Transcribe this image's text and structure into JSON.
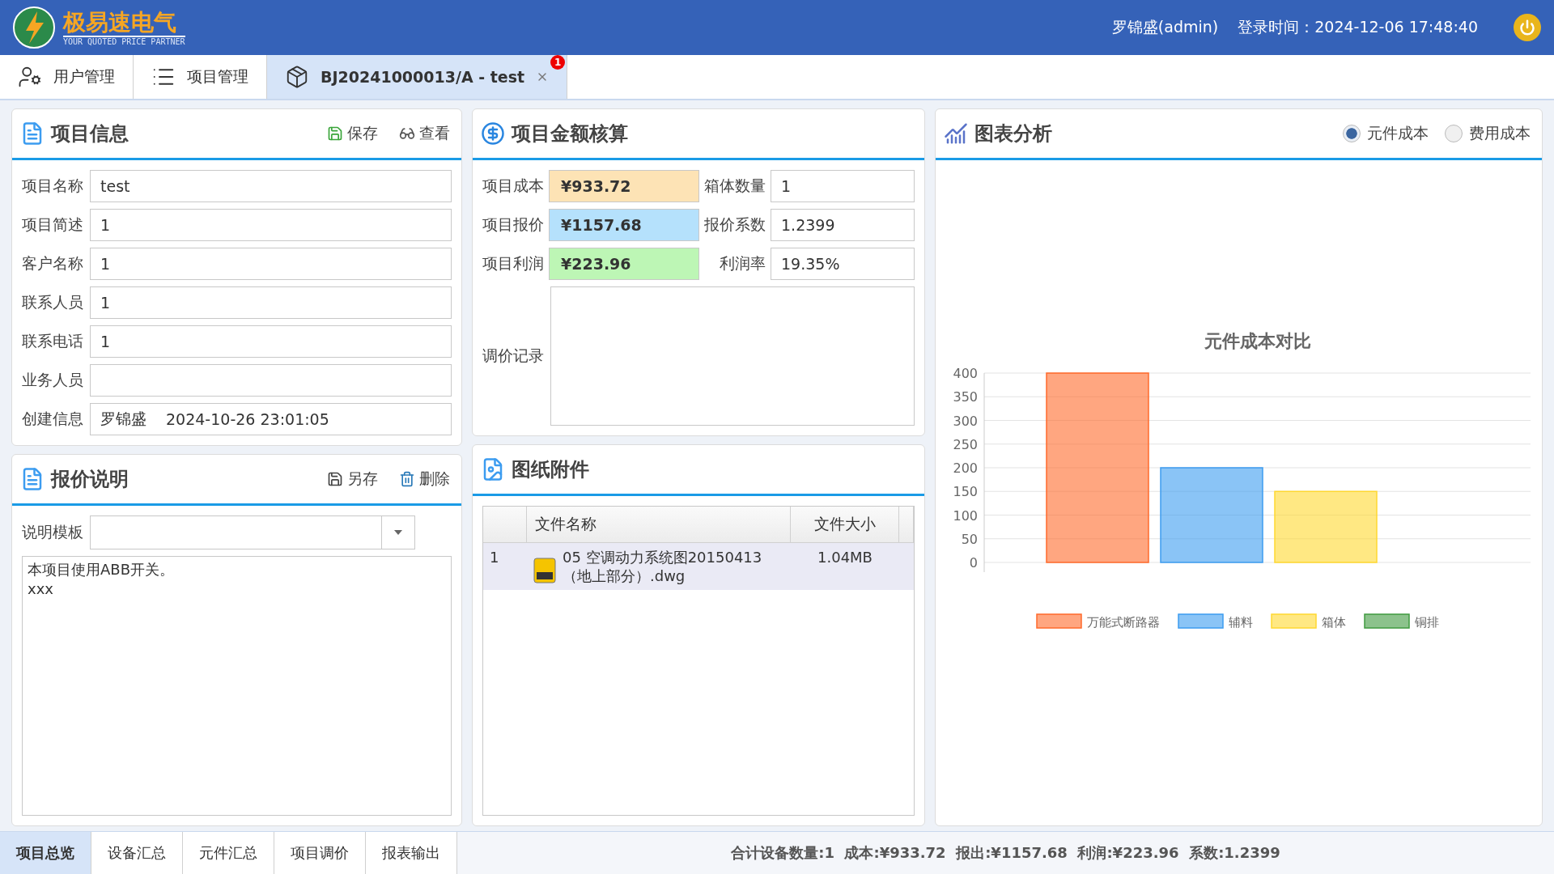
{
  "header": {
    "brand": "极易速电气",
    "tagline": "YOUR QUOTED PRICE PARTNER",
    "user": "罗锦盛(admin)",
    "login_time": "登录时间：2024-12-06 17:48:40"
  },
  "tabs": [
    {
      "label": "用户管理",
      "kind": "user",
      "selected": false
    },
    {
      "label": "项目管理",
      "kind": "list",
      "selected": false
    },
    {
      "label": "BJ20241000013/A - test",
      "kind": "box",
      "selected": true,
      "badge": "1"
    }
  ],
  "project_info": {
    "title": "项目信息",
    "actions": [
      {
        "label": "保存",
        "kind": "save"
      },
      {
        "label": "查看",
        "kind": "view"
      }
    ],
    "fields": [
      {
        "label": "项目名称",
        "value": "test"
      },
      {
        "label": "项目简述",
        "value": "1"
      },
      {
        "label": "客户名称",
        "value": "1"
      },
      {
        "label": "联系人员",
        "value": "1"
      },
      {
        "label": "联系电话",
        "value": "1"
      },
      {
        "label": "业务人员"
      },
      {
        "label": "创建信息",
        "value": "罗锦盛",
        "value_2": "2024-10-26 23:01:05"
      }
    ]
  },
  "amounts": {
    "title": "项目金额核算",
    "rows": [
      {
        "label": "项目成本",
        "value": "¥933.72",
        "color": "#fde3b5",
        "label_2": "箱体数量",
        "value_2": "1"
      },
      {
        "label": "项目报价",
        "value": "¥1157.68",
        "color": "#b5e1fc",
        "label_2": "报价系数",
        "value_2": "1.2399"
      },
      {
        "label": "项目利润",
        "value": "¥223.96",
        "color": "#bdf6b5",
        "label_2": "利润率",
        "value_2": "19.35%"
      }
    ],
    "log_label": "调价记录"
  },
  "quote_note": {
    "title": "报价说明",
    "actions": [
      {
        "label": "另存",
        "kind": "saveas"
      },
      {
        "label": "删除",
        "kind": "delete"
      }
    ],
    "template_label": "说明模板",
    "text": "本项目使用ABB开关。\nxxx"
  },
  "attachments": {
    "title": "图纸附件",
    "columns": [
      "文件名称",
      "文件大小"
    ],
    "rows": [
      {
        "index": "1",
        "name": "05 空调动力系统图20150413（地上部分）.dwg",
        "size": "1.04MB",
        "selected": true
      }
    ]
  },
  "chart_panel": {
    "title": "图表分析",
    "options": [
      {
        "label": "元件成本",
        "selected": true
      },
      {
        "label": "费用成本",
        "selected": false
      }
    ],
    "chart_data": {
      "type": "bar",
      "title": "元件成本对比",
      "grid": true,
      "legend": true,
      "ylim": [
        0,
        400
      ],
      "yticks": [
        0,
        50,
        100,
        150,
        200,
        250,
        300,
        350,
        400
      ],
      "series": [
        {
          "name": "万能式断路器",
          "color": "#ff6a2b",
          "values": [
            400
          ]
        },
        {
          "name": "辅料",
          "color": "#3c9cf0",
          "values": [
            200
          ]
        },
        {
          "name": "箱体",
          "color": "#ffd830",
          "values": [
            150
          ]
        },
        {
          "name": "铜排",
          "color": "#3f9a3f",
          "values": [
            0
          ]
        }
      ]
    }
  },
  "bottom_tabs": [
    {
      "label": "项目总览",
      "selected": true
    },
    {
      "label": "设备汇总",
      "selected": false
    },
    {
      "label": "元件汇总",
      "selected": false
    },
    {
      "label": "项目调价",
      "selected": false
    },
    {
      "label": "报表输出",
      "selected": false
    }
  ],
  "summary": "合计设备数量:1  成本:¥933.72  报出:¥1157.68  利润:¥223.96  系数:1.2399"
}
